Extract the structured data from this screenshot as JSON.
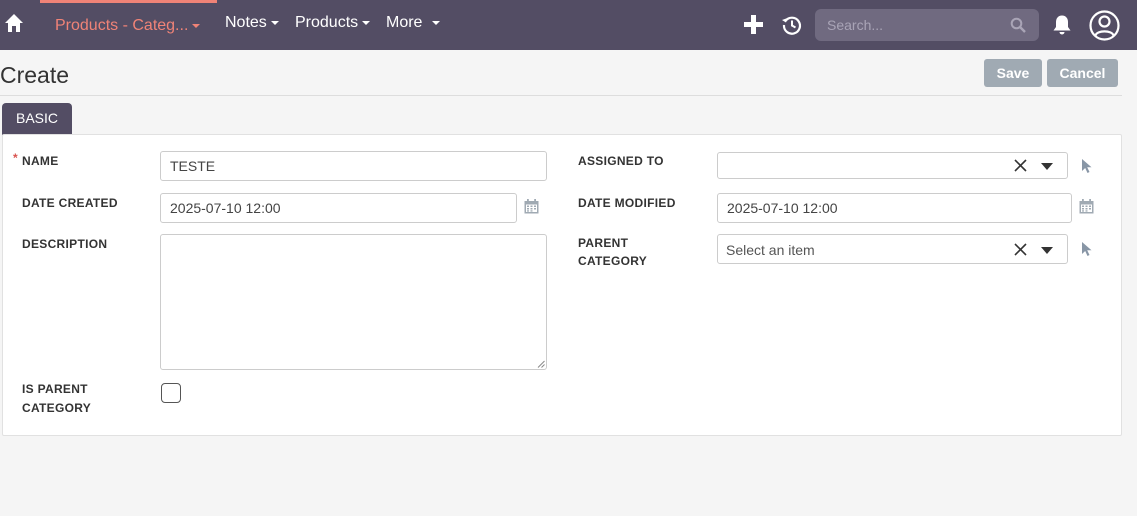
{
  "nav": {
    "active_module": "Products - Categ...",
    "items": [
      "Notes",
      "Products",
      "More"
    ],
    "search_placeholder": "Search..."
  },
  "header": {
    "title": "Create",
    "save_label": "Save",
    "cancel_label": "Cancel"
  },
  "tabs": [
    "BASIC"
  ],
  "form": {
    "name_label": "NAME",
    "name_value": "TESTE",
    "date_created_label": "DATE CREATED",
    "date_created_value": "2025-07-10 12:00",
    "description_label": "DESCRIPTION",
    "is_parent_label_1": "IS PARENT",
    "is_parent_label_2": "CATEGORY",
    "is_parent_checked": false,
    "assigned_to_label": "ASSIGNED TO",
    "assigned_to_value": "",
    "date_modified_label": "DATE MODIFIED",
    "date_modified_value": "2025-07-10 12:00",
    "parent_category_label_1": "PARENT",
    "parent_category_label_2": "CATEGORY",
    "parent_category_placeholder": "Select an item"
  },
  "colors": {
    "nav_bg": "#534d64",
    "accent": "#f08377",
    "button_bg": "#a0aab3"
  }
}
